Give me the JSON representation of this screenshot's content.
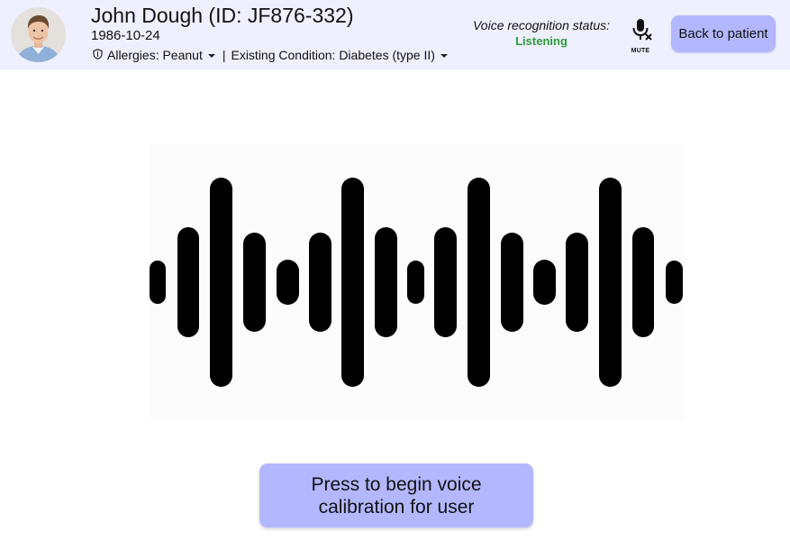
{
  "patient": {
    "name": "John Dough (ID: JF876-332)",
    "dob": "1986-10-24",
    "allergies": "Allergies: Peanut",
    "separator": "|",
    "condition": "Existing Condition: Diabetes (type II)"
  },
  "voice": {
    "status_label": "Voice recognition status:",
    "status_value": "Listening",
    "status_color": "#2e9b3a",
    "mute_label": "MUTE"
  },
  "header": {
    "back_label": "Back to patient",
    "background": "#eef0ff"
  },
  "main": {
    "calibrate_label": "Press to begin voice calibration for user",
    "button_color": "#b3b7ff"
  },
  "icons": {
    "avatar": "avatar",
    "shield": "shield-icon",
    "mute": "microphone-muted-icon",
    "waveform": "sound-wave-icon"
  }
}
